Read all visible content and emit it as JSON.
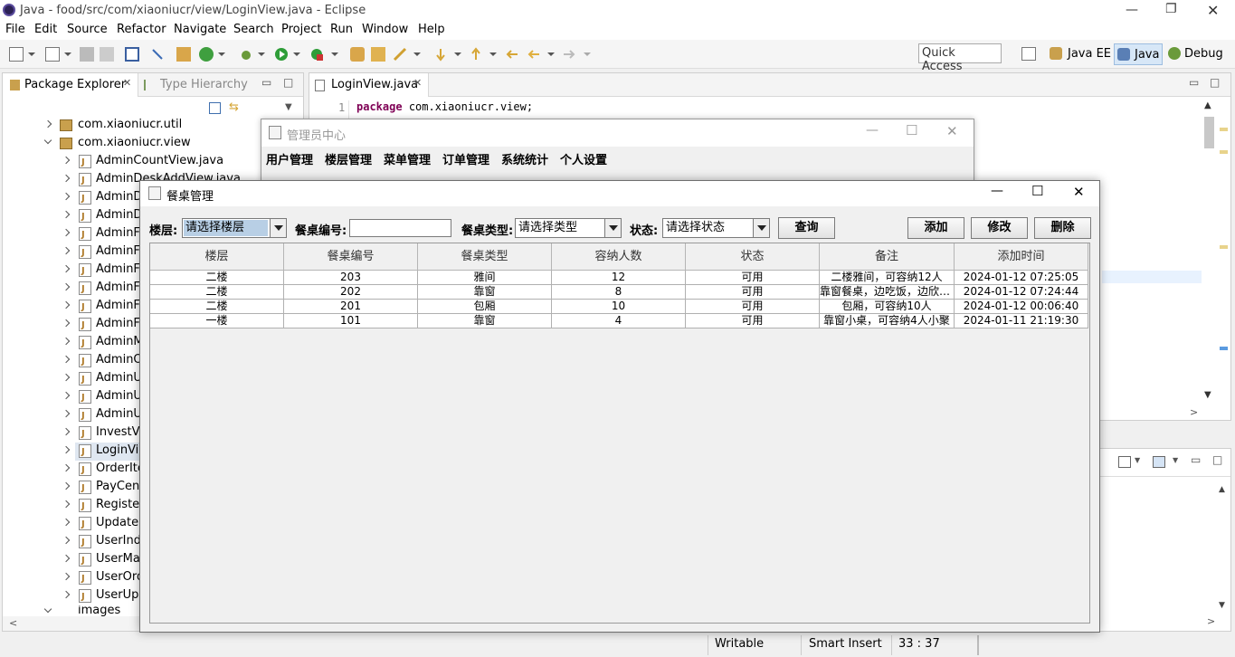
{
  "eclipse": {
    "title": "Java - food/src/com/xiaoniucr/view/LoginView.java - Eclipse",
    "menu": [
      "File",
      "Edit",
      "Source",
      "Refactor",
      "Navigate",
      "Search",
      "Project",
      "Run",
      "Window",
      "Help"
    ],
    "quick_access": "Quick Access",
    "perspectives": [
      "Java EE",
      "Java",
      "Debug"
    ]
  },
  "explorer": {
    "tabs": [
      "Package Explorer",
      "Type Hierarchy"
    ],
    "packages": [
      "com.xiaoniucr.util",
      "com.xiaoniucr.view"
    ],
    "files": [
      "AdminCountView.java",
      "AdminDeskAddView.java",
      "AdminDe",
      "AdminDe",
      "AdminFlo",
      "AdminFlo",
      "AdminFlo",
      "AdminFo",
      "AdminFo",
      "AdminFo",
      "AdminM",
      "AdminOr",
      "AdminUs",
      "AdminUs",
      "AdminUs",
      "InvestVie",
      "LoginVie",
      "OrderIte",
      "PayCente",
      "Register",
      "UpdateP",
      "UserInde",
      "UserMai",
      "UserOrd",
      "UserUpd"
    ],
    "images_folder": "images"
  },
  "editor": {
    "tab": "LoginView.java",
    "line_number": "1",
    "keyword": "package",
    "code": "com.xiaoniucr.view;"
  },
  "status": {
    "writable": "Writable",
    "insert": "Smart Insert",
    "position": "33 : 37"
  },
  "admin_window": {
    "title": "管理员中心",
    "menu": [
      "用户管理",
      "楼层管理",
      "菜单管理",
      "订单管理",
      "系统统计",
      "个人设置"
    ]
  },
  "dialog": {
    "title": "餐桌管理",
    "floor_label": "楼层:",
    "floor_value": "请选择楼层",
    "number_label": "餐桌编号:",
    "number_value": "",
    "type_label": "餐桌类型:",
    "type_value": "请选择类型",
    "status_label": "状态:",
    "status_value": "请选择状态",
    "query_button": "查询",
    "add_button": "添加",
    "edit_button": "修改",
    "delete_button": "删除"
  },
  "table": {
    "headers": [
      "楼层",
      "餐桌编号",
      "餐桌类型",
      "容纳人数",
      "状态",
      "备注",
      "添加时间"
    ],
    "rows": [
      [
        "二楼",
        "203",
        "雅间",
        "12",
        "可用",
        "二楼雅间，可容纳12人",
        "2024-01-12 07:25:05"
      ],
      [
        "二楼",
        "202",
        "靠窗",
        "8",
        "可用",
        "靠窗餐桌，边吃饭，边欣赏风景",
        "2024-01-12 07:24:44"
      ],
      [
        "二楼",
        "201",
        "包厢",
        "10",
        "可用",
        "包厢，可容纳10人",
        "2024-01-12 00:06:40"
      ],
      [
        "一楼",
        "101",
        "靠窗",
        "4",
        "可用",
        "靠窗小桌，可容纳4人小聚",
        "2024-01-11 21:19:30"
      ]
    ]
  }
}
